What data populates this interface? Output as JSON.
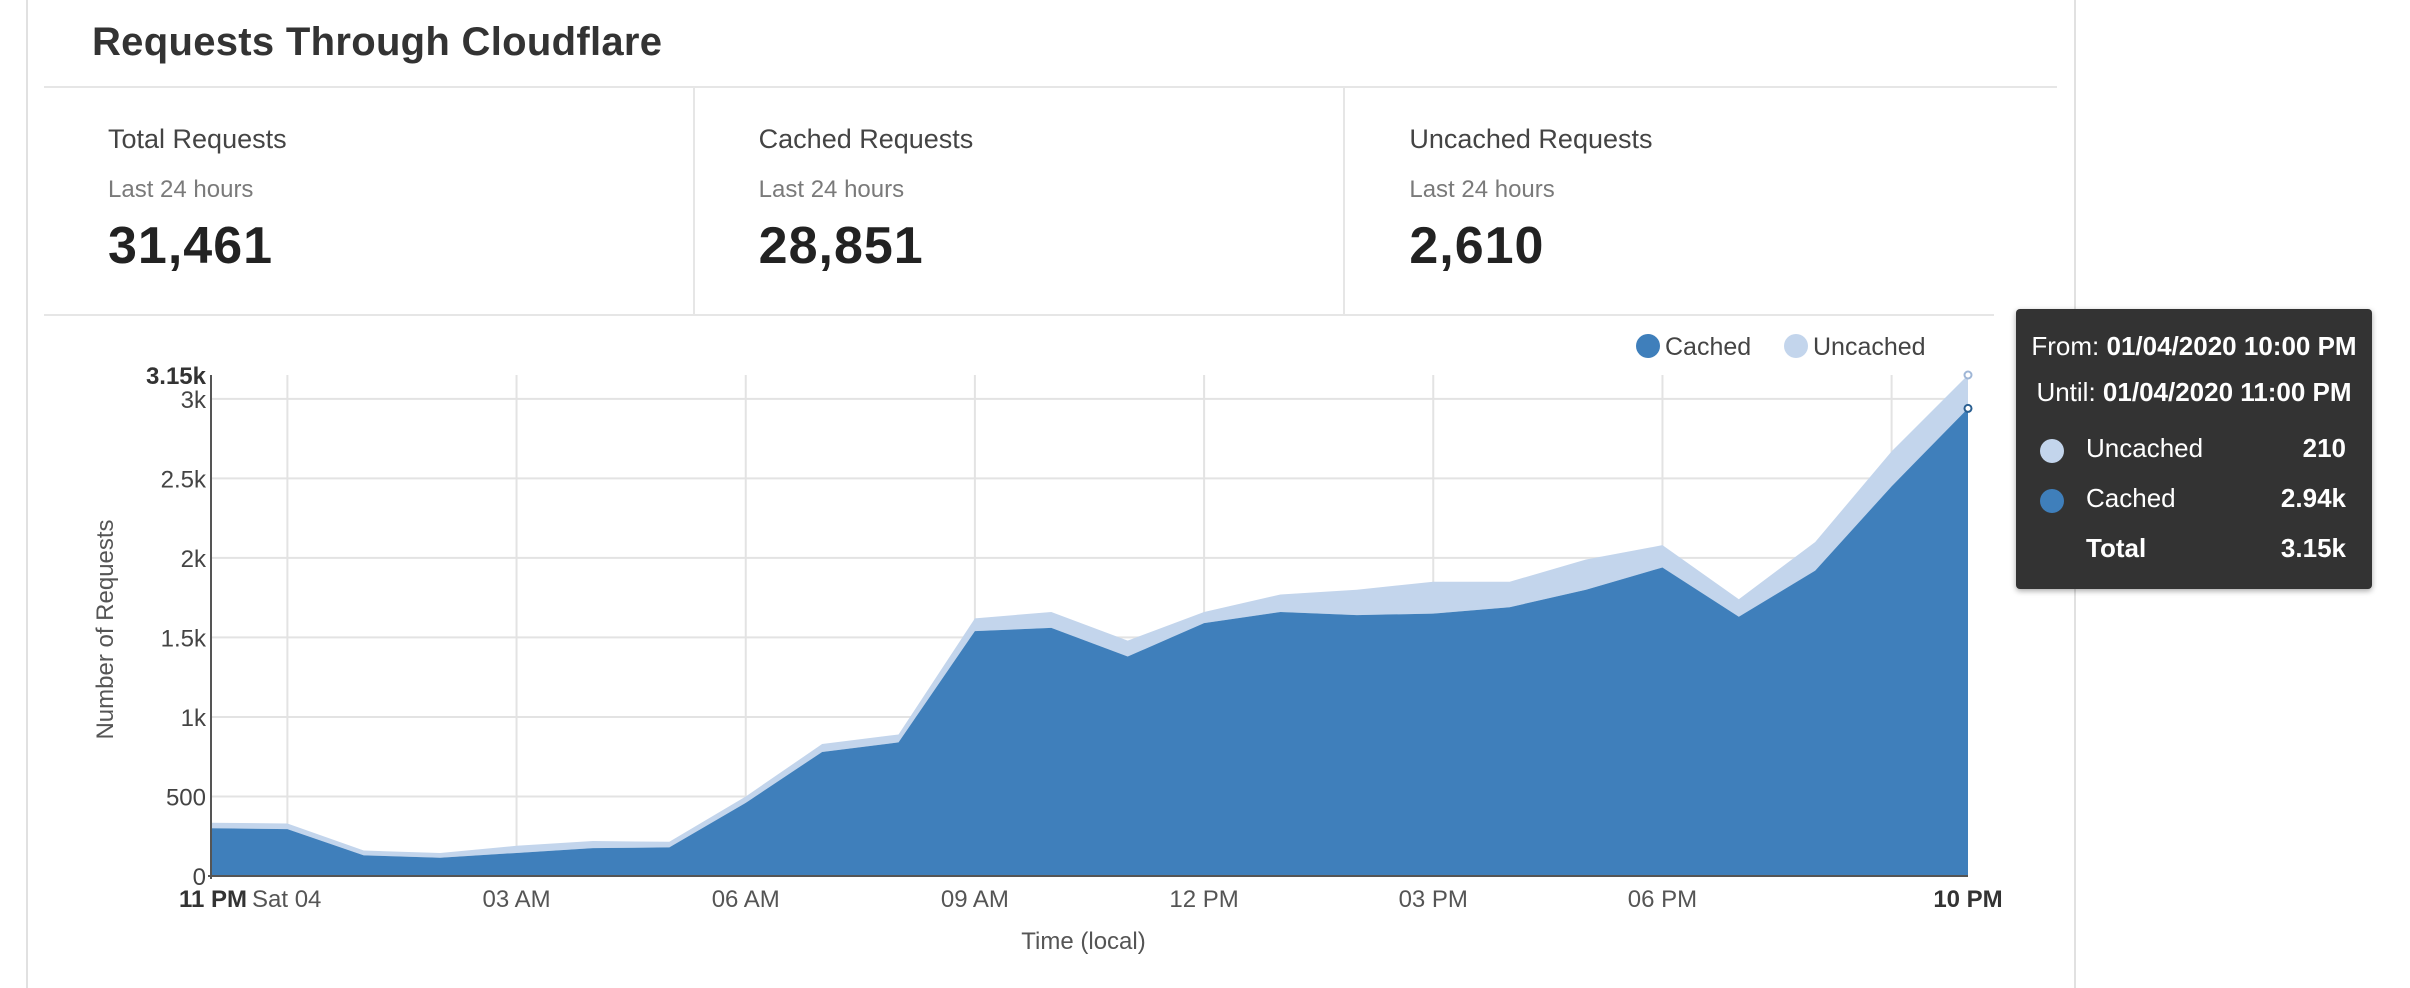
{
  "card": {
    "title": "Requests Through Cloudflare"
  },
  "stats": [
    {
      "label": "Total Requests",
      "period": "Last 24 hours",
      "value": "31,461"
    },
    {
      "label": "Cached Requests",
      "period": "Last 24 hours",
      "value": "28,851"
    },
    {
      "label": "Uncached Requests",
      "period": "Last 24 hours",
      "value": "2,610"
    }
  ],
  "colors": {
    "cached": "#3f7fbb",
    "uncached": "#c3d5ec",
    "grid": "#e3e3e3",
    "axis": "#555555",
    "tooltip_bg": "#333333"
  },
  "tooltip": {
    "from_label": "From:",
    "from_value": "01/04/2020 10:00 PM",
    "until_label": "Until:",
    "until_value": "01/04/2020 11:00 PM",
    "rows": [
      {
        "name": "Uncached",
        "value": "210",
        "color": "#c3d5ec"
      },
      {
        "name": "Cached",
        "value": "2.94k",
        "color": "#3f7fbb"
      },
      {
        "name": "Total",
        "value": "3.15k"
      }
    ]
  },
  "chart_data": {
    "type": "area",
    "stacked": true,
    "title": "",
    "xlabel": "Time (local)",
    "ylabel": "Number of Requests",
    "x": [
      0,
      1,
      2,
      3,
      4,
      5,
      6,
      7,
      8,
      9,
      10,
      11,
      12,
      13,
      14,
      15,
      16,
      17,
      18,
      19,
      20,
      21,
      22,
      23
    ],
    "xlim": [
      0,
      23
    ],
    "ylim": [
      0,
      3150
    ],
    "y_ticks": [
      {
        "value": 0,
        "label": "0"
      },
      {
        "value": 500,
        "label": "500"
      },
      {
        "value": 1000,
        "label": "1k"
      },
      {
        "value": 1500,
        "label": "1.5k"
      },
      {
        "value": 2000,
        "label": "2k"
      },
      {
        "value": 2500,
        "label": "2.5k"
      },
      {
        "value": 3000,
        "label": "3k"
      },
      {
        "value": 3150,
        "label": "3.15k",
        "bold": true
      }
    ],
    "x_ticks": [
      {
        "value": 0,
        "label": "11 PM",
        "bold": true,
        "suffix": "Sat 04"
      },
      {
        "value": 1,
        "label": ""
      },
      {
        "value": 4,
        "label": "03 AM"
      },
      {
        "value": 7,
        "label": "06 AM"
      },
      {
        "value": 10,
        "label": "09 AM"
      },
      {
        "value": 13,
        "label": "12 PM"
      },
      {
        "value": 16,
        "label": "03 PM"
      },
      {
        "value": 19,
        "label": "06 PM"
      },
      {
        "value": 22,
        "label": ""
      },
      {
        "value": 23,
        "label": "10 PM",
        "bold": true
      }
    ],
    "grid": true,
    "legend_position": "top-right",
    "series": [
      {
        "name": "Cached",
        "color": "#3f7fbb",
        "values": [
          300,
          295,
          130,
          115,
          145,
          175,
          180,
          460,
          780,
          840,
          1540,
          1560,
          1380,
          1590,
          1660,
          1640,
          1650,
          1690,
          1800,
          1940,
          1630,
          1920,
          2450,
          2940
        ]
      },
      {
        "name": "Uncached",
        "color": "#c3d5ec",
        "values": [
          35,
          35,
          30,
          30,
          45,
          45,
          35,
          40,
          50,
          50,
          80,
          100,
          100,
          70,
          110,
          160,
          200,
          160,
          190,
          140,
          110,
          180,
          220,
          210
        ]
      }
    ]
  }
}
